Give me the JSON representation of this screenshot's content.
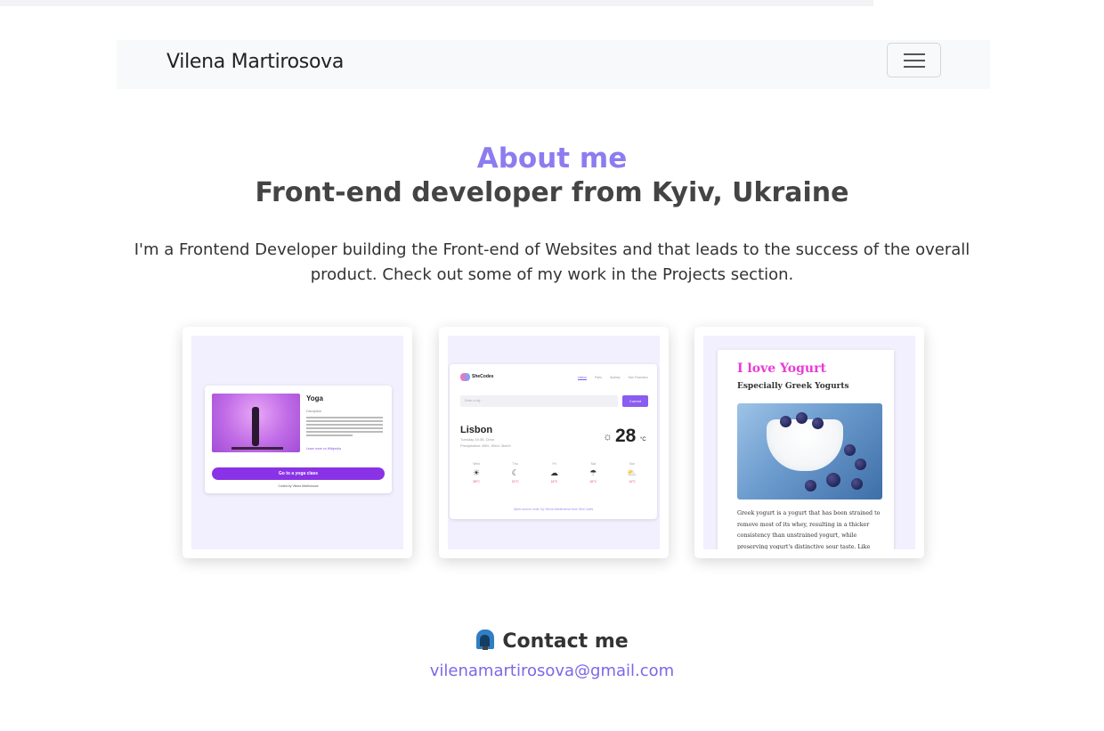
{
  "navbar": {
    "brand": "Vilena Martirosova",
    "toggler_icon": "hamburger-menu-icon"
  },
  "about": {
    "title": "About me",
    "subtitle": "Front-end developer from Kyiv, Ukraine",
    "intro": "I'm a Frontend Developer building the Front-end of Websites and that leads to the success of the overall product. Check out some of my work in the Projects section."
  },
  "projects": {
    "yoga": {
      "title": "Yoga",
      "subtitle": "Discipline",
      "link": "Learn more on Wikipedia",
      "button": "Go to a yoga class",
      "credit": "Coded by Vilena Martirosova"
    },
    "weather": {
      "logo": "SheCodes",
      "nav": [
        "Lisbon",
        "Paris",
        "Sydney",
        "San Francisco"
      ],
      "search_placeholder": "Enter a city",
      "current_button": "Current",
      "city": "Lisbon",
      "date": "Tuesday 16:35, Clear",
      "precip": "Precipitation: 68%, Wind: 3km/h",
      "temp": "28",
      "unit": "°C",
      "forecast": [
        {
          "day": "Wed",
          "icon": "☀",
          "temp": "28°C"
        },
        {
          "day": "Thu",
          "icon": "☾",
          "temp": "21°C"
        },
        {
          "day": "Fri",
          "icon": "☁",
          "temp": "16°C"
        },
        {
          "day": "Sat",
          "icon": "☂",
          "temp": "16°C"
        },
        {
          "day": "Sun",
          "icon": "⛅",
          "temp": "14°C"
        }
      ],
      "footer": "Open-source code, by Vilena Martirosova from SheCodes"
    },
    "yogurt": {
      "title": "I love Yogurt",
      "subtitle": "Especially Greek Yogurts",
      "text": "Greek yogurt is a yogurt that has been strained to remove most of its whey, resulting in a thicker consistency than unstrained yogurt, while preserving yogurt's distinctive sour taste. Like many types of yogurt, strained yogurt is"
    }
  },
  "contact": {
    "icon": "mailbox-icon",
    "title": "Contact me",
    "email": "vilenamartirosova@gmail.com"
  },
  "colors": {
    "accent": "#8c7cf0",
    "link": "#7a68e8"
  }
}
